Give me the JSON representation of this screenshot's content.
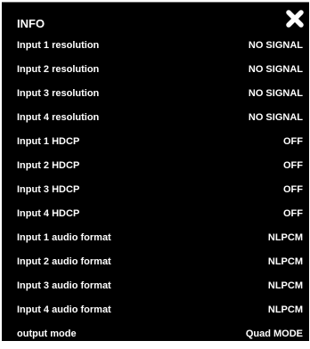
{
  "panel": {
    "title": "INFO",
    "close_icon": "close-x-icon",
    "colors": {
      "background": "#000000",
      "text": "#ffffff"
    }
  },
  "rows": [
    {
      "label": "Input 1 resolution",
      "value": "NO SIGNAL"
    },
    {
      "label": "Input 2 resolution",
      "value": "NO SIGNAL"
    },
    {
      "label": "Input 3 resolution",
      "value": "NO SIGNAL"
    },
    {
      "label": "Input 4 resolution",
      "value": "NO SIGNAL"
    },
    {
      "label": "Input 1 HDCP",
      "value": "OFF"
    },
    {
      "label": "Input 2 HDCP",
      "value": "OFF"
    },
    {
      "label": "Input 3 HDCP",
      "value": "OFF"
    },
    {
      "label": "Input 4 HDCP",
      "value": "OFF"
    },
    {
      "label": "Input 1 audio format",
      "value": "NLPCM"
    },
    {
      "label": "Input 2 audio format",
      "value": "NLPCM"
    },
    {
      "label": "Input 3 audio format",
      "value": "NLPCM"
    },
    {
      "label": "Input 4 audio format",
      "value": "NLPCM"
    },
    {
      "label": "output mode",
      "value": "Quad MODE"
    }
  ]
}
